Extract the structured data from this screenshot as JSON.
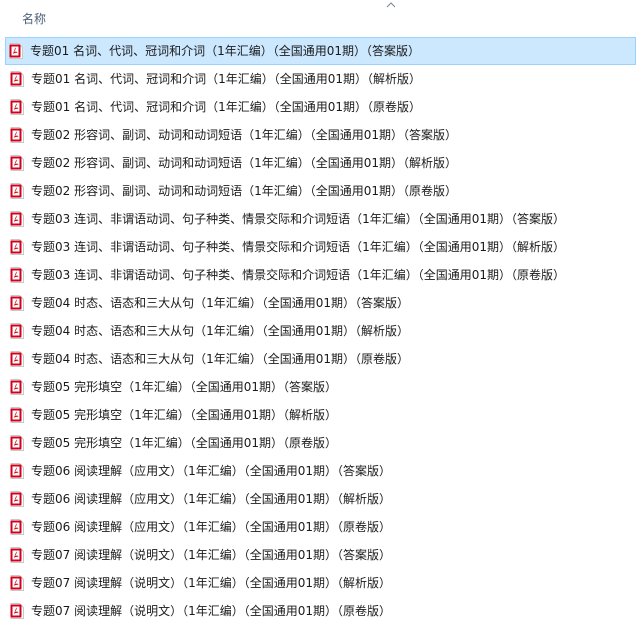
{
  "header": {
    "name_column": "名称"
  },
  "icons": {
    "sort": "sort-ascending-icon",
    "file": "pdf-file-icon"
  },
  "colors": {
    "selected_bg": "#cce8ff",
    "selected_border": "#99d1ff",
    "pdf_red": "#d0021b"
  },
  "files": [
    {
      "name": "专题01 名词、代词、冠词和介词（1年汇编）（全国通用01期）（答案版）",
      "selected": true
    },
    {
      "name": "专题01 名词、代词、冠词和介词（1年汇编）（全国通用01期）（解析版）",
      "selected": false
    },
    {
      "name": "专题01 名词、代词、冠词和介词（1年汇编）（全国通用01期）（原卷版）",
      "selected": false
    },
    {
      "name": "专题02 形容词、副词、动词和动词短语（1年汇编）（全国通用01期）（答案版）",
      "selected": false
    },
    {
      "name": "专题02 形容词、副词、动词和动词短语（1年汇编）（全国通用01期）（解析版）",
      "selected": false
    },
    {
      "name": "专题02 形容词、副词、动词和动词短语（1年汇编）（全国通用01期）（原卷版）",
      "selected": false
    },
    {
      "name": "专题03 连词、非谓语动词、句子种类、情景交际和介词短语（1年汇编）（全国通用01期）（答案版）",
      "selected": false
    },
    {
      "name": "专题03 连词、非谓语动词、句子种类、情景交际和介词短语（1年汇编）（全国通用01期）（解析版）",
      "selected": false
    },
    {
      "name": "专题03 连词、非谓语动词、句子种类、情景交际和介词短语（1年汇编）（全国通用01期）（原卷版）",
      "selected": false
    },
    {
      "name": "专题04 时态、语态和三大从句（1年汇编）（全国通用01期）（答案版）",
      "selected": false
    },
    {
      "name": "专题04 时态、语态和三大从句（1年汇编）（全国通用01期）（解析版）",
      "selected": false
    },
    {
      "name": "专题04 时态、语态和三大从句（1年汇编）（全国通用01期）（原卷版）",
      "selected": false
    },
    {
      "name": "专题05 完形填空（1年汇编）（全国通用01期）（答案版）",
      "selected": false
    },
    {
      "name": "专题05 完形填空（1年汇编）（全国通用01期）（解析版）",
      "selected": false
    },
    {
      "name": "专题05 完形填空（1年汇编）（全国通用01期）（原卷版）",
      "selected": false
    },
    {
      "name": "专题06 阅读理解（应用文）（1年汇编）（全国通用01期）（答案版）",
      "selected": false
    },
    {
      "name": "专题06 阅读理解（应用文）（1年汇编）（全国通用01期）（解析版）",
      "selected": false
    },
    {
      "name": "专题06 阅读理解（应用文）（1年汇编）（全国通用01期）（原卷版）",
      "selected": false
    },
    {
      "name": "专题07 阅读理解（说明文）（1年汇编）（全国通用01期）（答案版）",
      "selected": false
    },
    {
      "name": "专题07 阅读理解（说明文）（1年汇编）（全国通用01期）（解析版）",
      "selected": false
    },
    {
      "name": "专题07 阅读理解（说明文）（1年汇编）（全国通用01期）（原卷版）",
      "selected": false
    }
  ]
}
